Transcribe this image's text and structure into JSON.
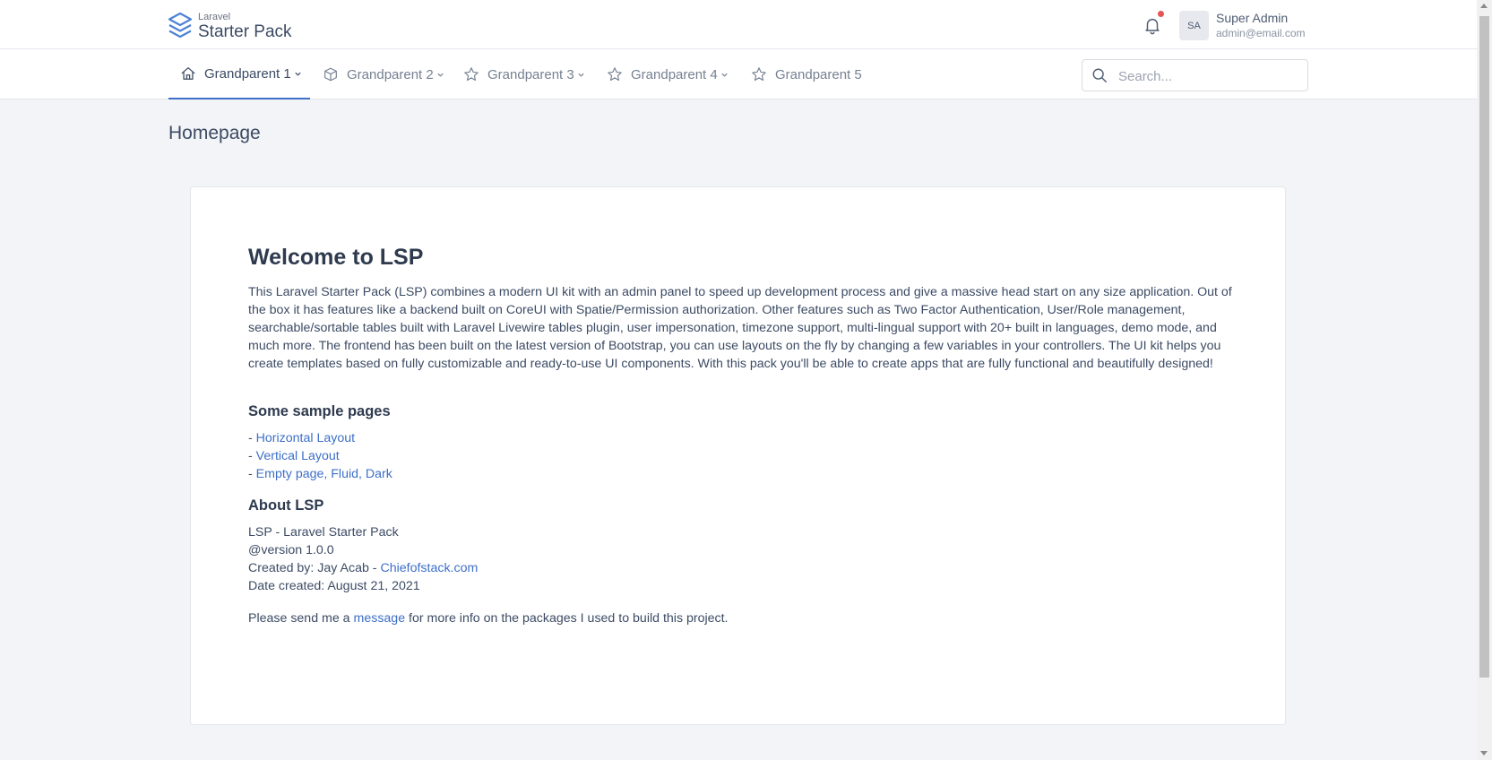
{
  "brand": {
    "small": "Laravel",
    "large": "Starter Pack",
    "logo_icon": "layers-icon",
    "logo_color": "#4e82d6"
  },
  "header": {
    "notifications_icon": "bell-icon",
    "has_unread_indicator": true,
    "user": {
      "initials": "SA",
      "name": "Super Admin",
      "email": "admin@email.com"
    }
  },
  "nav": {
    "items": [
      {
        "label": "Grandparent 1",
        "icon": "home-icon",
        "active": true,
        "has_dropdown": true
      },
      {
        "label": "Grandparent 2",
        "icon": "box-icon",
        "active": false,
        "has_dropdown": true
      },
      {
        "label": "Grandparent 3",
        "icon": "star-icon",
        "active": false,
        "has_dropdown": true
      },
      {
        "label": "Grandparent 4",
        "icon": "star-icon",
        "active": false,
        "has_dropdown": true
      },
      {
        "label": "Grandparent 5",
        "icon": "star-icon",
        "active": false,
        "has_dropdown": false
      }
    ],
    "search_placeholder": "Search..."
  },
  "page": {
    "title": "Homepage"
  },
  "card": {
    "heading": "Welcome to LSP",
    "intro": "This Laravel Starter Pack (LSP) combines a modern UI kit with an admin panel to speed up development process and give a massive head start on any size application. Out of the box it has features like a backend built on CoreUI with Spatie/Permission authorization. Other features such as Two Factor Authentication, User/Role management, searchable/sortable tables built with Laravel Livewire tables plugin, user impersonation, timezone support, multi-lingual support with 20+ built in languages, demo mode, and much more. The frontend has been built on the latest version of Bootstrap, you can use layouts on the fly by changing a few variables in your controllers. The UI kit helps you create templates based on fully customizable and ready-to-use UI components. With this pack you'll be able to create apps that are fully functional and beautifully designed!",
    "samples_heading": "Some sample pages",
    "sample_links": [
      {
        "prefix": "- ",
        "label": "Horizontal Layout"
      },
      {
        "prefix": "- ",
        "label": "Vertical Layout"
      },
      {
        "prefix": "- ",
        "label": "Empty page, Fluid, Dark"
      }
    ],
    "about_heading": "About LSP",
    "about": {
      "line1": "LSP - Laravel Starter Pack",
      "line2": "@version 1.0.0",
      "created_prefix": "Created by: Jay Acab - ",
      "created_link": "Chiefofstack.com",
      "line4": "Date created: August 21, 2021"
    },
    "message": {
      "before": "Please send me a ",
      "link": "message",
      "after": " for more info on the packages I used to build this project."
    }
  },
  "colors": {
    "accent": "#3d6fc8",
    "notification_dot": "#e55353",
    "page_bg": "#f3f4f7"
  }
}
